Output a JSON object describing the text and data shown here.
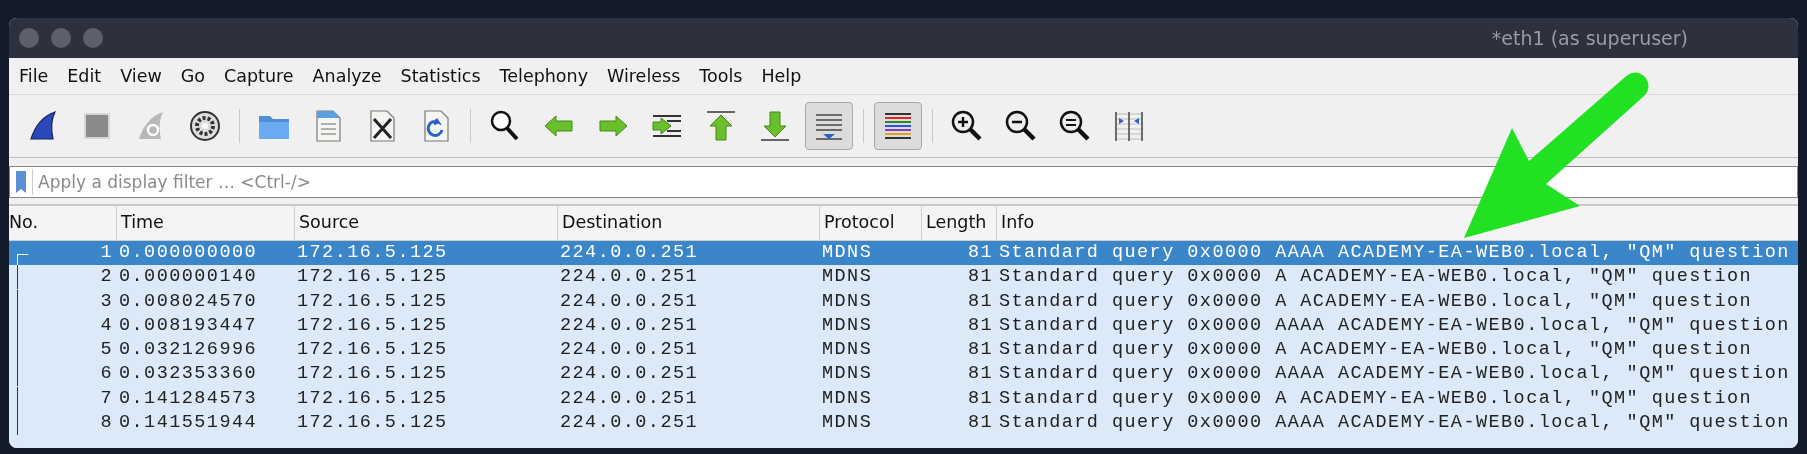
{
  "window": {
    "title": "*eth1 (as superuser)"
  },
  "menu": [
    "File",
    "Edit",
    "View",
    "Go",
    "Capture",
    "Analyze",
    "Statistics",
    "Telephony",
    "Wireless",
    "Tools",
    "Help"
  ],
  "toolbar": [
    {
      "kind": "start",
      "on": false
    },
    {
      "kind": "stop",
      "on": false
    },
    {
      "kind": "restart",
      "on": false
    },
    {
      "kind": "options",
      "on": false
    },
    {
      "kind": "sep"
    },
    {
      "kind": "open",
      "on": false
    },
    {
      "kind": "save",
      "on": false
    },
    {
      "kind": "close",
      "on": false
    },
    {
      "kind": "reload",
      "on": false
    },
    {
      "kind": "sep"
    },
    {
      "kind": "find",
      "on": false
    },
    {
      "kind": "back",
      "on": false
    },
    {
      "kind": "forward",
      "on": false
    },
    {
      "kind": "goto",
      "on": false
    },
    {
      "kind": "first",
      "on": false
    },
    {
      "kind": "last",
      "on": false
    },
    {
      "kind": "autoscroll",
      "on": true
    },
    {
      "kind": "sep"
    },
    {
      "kind": "colorize",
      "on": true
    },
    {
      "kind": "sep"
    },
    {
      "kind": "zoomin",
      "on": false
    },
    {
      "kind": "zoomout",
      "on": false
    },
    {
      "kind": "zoomnormal",
      "on": false
    },
    {
      "kind": "resize",
      "on": false
    }
  ],
  "filter": {
    "placeholder": "Apply a display filter … <Ctrl-/>"
  },
  "table": {
    "columns": [
      "No.",
      "Time",
      "Source",
      "Destination",
      "Protocol",
      "Length",
      "Info"
    ],
    "rows": [
      {
        "selected": true,
        "cells": [
          "1",
          "0.000000000",
          "172.16.5.125",
          "224.0.0.251",
          "MDNS",
          "81",
          "Standard query 0x0000 AAAA ACADEMY-EA-WEB0.local, \"QM\" question"
        ]
      },
      {
        "selected": false,
        "cells": [
          "2",
          "0.000000140",
          "172.16.5.125",
          "224.0.0.251",
          "MDNS",
          "81",
          "Standard query 0x0000 A ACADEMY-EA-WEB0.local, \"QM\" question"
        ]
      },
      {
        "selected": false,
        "cells": [
          "3",
          "0.008024570",
          "172.16.5.125",
          "224.0.0.251",
          "MDNS",
          "81",
          "Standard query 0x0000 A ACADEMY-EA-WEB0.local, \"QM\" question"
        ]
      },
      {
        "selected": false,
        "cells": [
          "4",
          "0.008193447",
          "172.16.5.125",
          "224.0.0.251",
          "MDNS",
          "81",
          "Standard query 0x0000 AAAA ACADEMY-EA-WEB0.local, \"QM\" question"
        ]
      },
      {
        "selected": false,
        "cells": [
          "5",
          "0.032126996",
          "172.16.5.125",
          "224.0.0.251",
          "MDNS",
          "81",
          "Standard query 0x0000 A ACADEMY-EA-WEB0.local, \"QM\" question"
        ]
      },
      {
        "selected": false,
        "cells": [
          "6",
          "0.032353360",
          "172.16.5.125",
          "224.0.0.251",
          "MDNS",
          "81",
          "Standard query 0x0000 AAAA ACADEMY-EA-WEB0.local, \"QM\" question"
        ]
      },
      {
        "selected": false,
        "cells": [
          "7",
          "0.141284573",
          "172.16.5.125",
          "224.0.0.251",
          "MDNS",
          "81",
          "Standard query 0x0000 A ACADEMY-EA-WEB0.local, \"QM\" question"
        ]
      },
      {
        "selected": false,
        "cells": [
          "8",
          "0.141551944",
          "172.16.5.125",
          "224.0.0.251",
          "MDNS",
          "81",
          "Standard query 0x0000 AAAA ACADEMY-EA-WEB0.local, \"QM\" question"
        ]
      }
    ]
  }
}
